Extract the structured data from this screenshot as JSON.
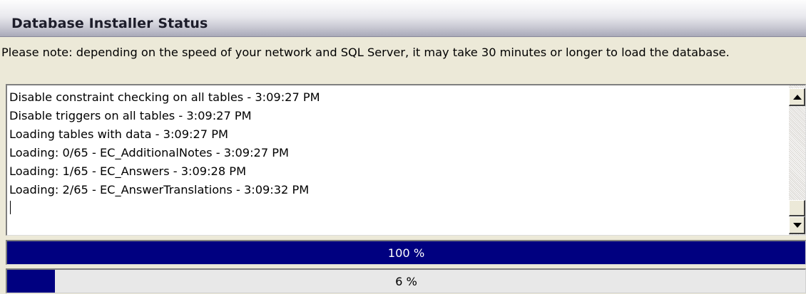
{
  "header": {
    "title": "Database Installer Status"
  },
  "note": "Please note: depending on the speed of your network and SQL Server, it may take 30 minutes or longer to load the database.",
  "log": {
    "lines": [
      "Disable constraint checking on all tables - 3:09:27 PM",
      "Disable triggers on all tables - 3:09:27 PM",
      "Loading tables with data - 3:09:27 PM",
      "Loading: 0/65 -  EC_AdditionalNotes - 3:09:27 PM",
      "Loading: 1/65 -  EC_Answers - 3:09:28 PM",
      "Loading: 2/65 -  EC_AnswerTranslations - 3:09:32 PM"
    ]
  },
  "scrollbar": {
    "up_icon": "scroll-up-arrow-icon",
    "down_icon": "scroll-down-arrow-icon"
  },
  "progress": {
    "overall": {
      "label": "100 %",
      "value": 100
    },
    "current": {
      "label": "6 %",
      "value": 6
    }
  },
  "colors": {
    "progress_fill": "#000080",
    "background": "#ece9d8"
  }
}
